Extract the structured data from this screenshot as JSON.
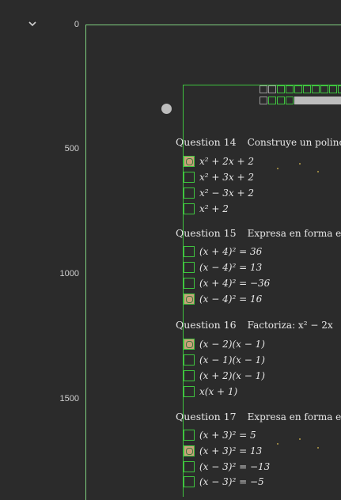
{
  "ruler": {
    "ticks": [
      "0",
      "500",
      "1000",
      "1500"
    ]
  },
  "questions": [
    {
      "label": "Question 14",
      "prompt": "Construye un polinor",
      "options": [
        "x² + 2x + 2",
        "x² + 3x + 2",
        "x² − 3x + 2",
        "x² + 2"
      ],
      "marked": 0
    },
    {
      "label": "Question 15",
      "prompt": "Expresa en forma est",
      "options": [
        "(x + 4)² = 36",
        "(x − 4)² = 13",
        "(x + 4)² = −36",
        "(x − 4)² = 16"
      ],
      "marked": 3
    },
    {
      "label": "Question 16",
      "prompt": "Factoriza:  x² − 2x",
      "options": [
        "(x − 2)(x − 1)",
        "(x − 1)(x − 1)",
        "(x + 2)(x − 1)",
        "x(x + 1)"
      ],
      "marked": 0
    },
    {
      "label": "Question 17",
      "prompt": "Expresa en forma est",
      "options": [
        "(x + 3)² = 5",
        "(x + 3)² = 13",
        "(x − 3)² = −13",
        "(x − 3)² = −5"
      ],
      "marked": 1
    }
  ]
}
